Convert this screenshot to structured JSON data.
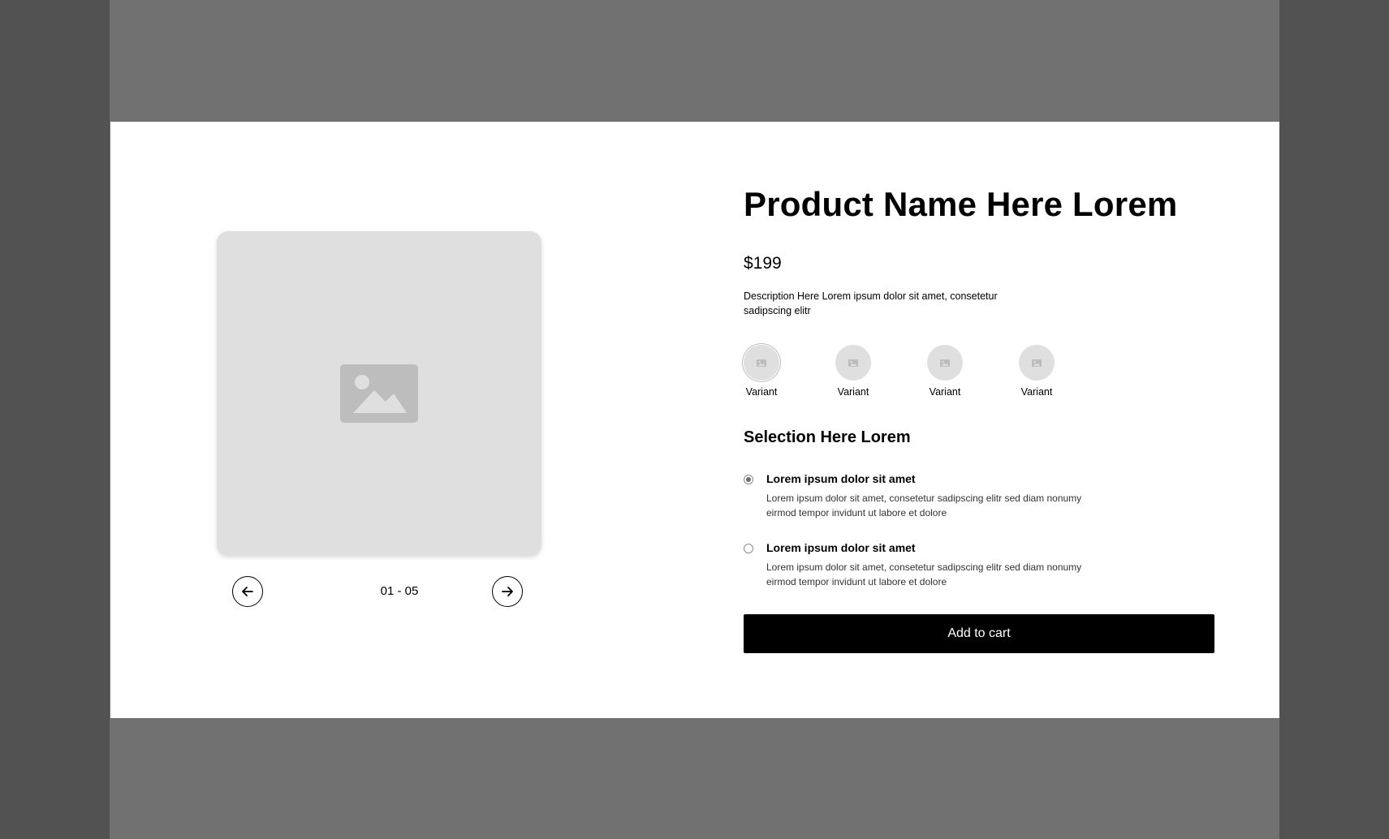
{
  "gallery": {
    "main_image_icon": "image-placeholder-icon",
    "prev_icon": "arrow-left-icon",
    "next_icon": "arrow-right-icon",
    "page_counter": "01 - 05"
  },
  "product": {
    "title": "Product Name Here Lorem",
    "price": "$199",
    "description": "Description Here Lorem ipsum dolor sit amet, consetetur sadipscing elitr"
  },
  "variants": [
    {
      "label": "Variant",
      "selected": true
    },
    {
      "label": "Variant",
      "selected": false
    },
    {
      "label": "Variant",
      "selected": false
    },
    {
      "label": "Variant",
      "selected": false
    }
  ],
  "selection": {
    "heading": "Selection Here Lorem",
    "options": [
      {
        "title": "Lorem ipsum dolor sit amet",
        "description": "Lorem ipsum dolor sit amet, consetetur sadipscing elitr sed diam nonumy eirmod tempor invidunt ut labore et dolore",
        "checked": true
      },
      {
        "title": "Lorem ipsum dolor sit amet",
        "description": "Lorem ipsum dolor sit amet, consetetur sadipscing elitr sed diam nonumy eirmod tempor invidunt ut labore et dolore",
        "checked": false
      }
    ]
  },
  "cart": {
    "button_label": "Add to cart"
  },
  "colors": {
    "placeholder": "#dfdfdf",
    "placeholder_icon": "#bdbdbd",
    "button_bg": "#000000",
    "outer_bg": "#525252",
    "frame_bg": "#717171"
  }
}
